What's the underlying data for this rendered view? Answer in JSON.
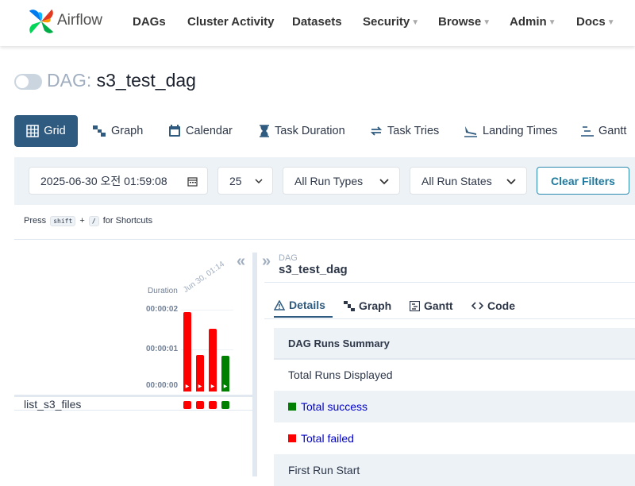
{
  "nav": {
    "brand": "Airflow",
    "items": [
      {
        "label": "DAGs"
      },
      {
        "label": "Cluster Activity"
      },
      {
        "label": "Datasets"
      },
      {
        "label": "Security",
        "dropdown": true
      },
      {
        "label": "Browse",
        "dropdown": true
      },
      {
        "label": "Admin",
        "dropdown": true
      },
      {
        "label": "Docs",
        "dropdown": true
      }
    ]
  },
  "dag": {
    "title_prefix": "DAG:",
    "name": "s3_test_dag",
    "paused": true
  },
  "view_tabs": [
    {
      "label": "Grid",
      "icon": "grid-icon",
      "active": true
    },
    {
      "label": "Graph",
      "icon": "graph-icon"
    },
    {
      "label": "Calendar",
      "icon": "calendar-icon"
    },
    {
      "label": "Task Duration",
      "icon": "hourglass-icon"
    },
    {
      "label": "Task Tries",
      "icon": "retry-icon"
    },
    {
      "label": "Landing Times",
      "icon": "landing-icon"
    },
    {
      "label": "Gantt",
      "icon": "gantt-icon"
    }
  ],
  "filters": {
    "base_date": "2025-06-30 오전 01:59:08",
    "num_runs": "25",
    "run_type": "All Run Types",
    "run_state": "All Run States",
    "clear_label": "Clear Filters"
  },
  "shortcuts": {
    "press": "Press",
    "key1": "shift",
    "plus": "+",
    "key2": "/",
    "suffix": "for Shortcuts"
  },
  "grid": {
    "duration_label": "Duration",
    "date_label": "Jun 30, 01:14",
    "ticks": [
      "00:00:02",
      "00:00:01",
      "00:00:00"
    ],
    "runs": [
      {
        "duration_fraction": 0.96,
        "state": "failed"
      },
      {
        "duration_fraction": 0.44,
        "state": "failed"
      },
      {
        "duration_fraction": 0.76,
        "state": "failed"
      },
      {
        "duration_fraction": 0.43,
        "state": "success"
      }
    ],
    "task": {
      "name": "list_s3_files",
      "states": [
        "failed",
        "failed",
        "failed",
        "success"
      ]
    }
  },
  "colors": {
    "failed": "#ff0000",
    "success": "#008000",
    "accent": "#2f5b80"
  },
  "details": {
    "breadcrumb_label": "DAG",
    "dag_name": "s3_test_dag",
    "tabs": [
      {
        "label": "Details",
        "icon": "warning-icon",
        "active": true
      },
      {
        "label": "Graph",
        "icon": "graph-icon"
      },
      {
        "label": "Gantt",
        "icon": "gantt-icon"
      },
      {
        "label": "Code",
        "icon": "code-icon"
      }
    ],
    "table_header": "DAG Runs Summary",
    "rows": [
      {
        "label": "Total Runs Displayed"
      },
      {
        "label": "Total success",
        "state": "success"
      },
      {
        "label": "Total failed",
        "state": "failed"
      },
      {
        "label": "First Run Start"
      }
    ]
  }
}
